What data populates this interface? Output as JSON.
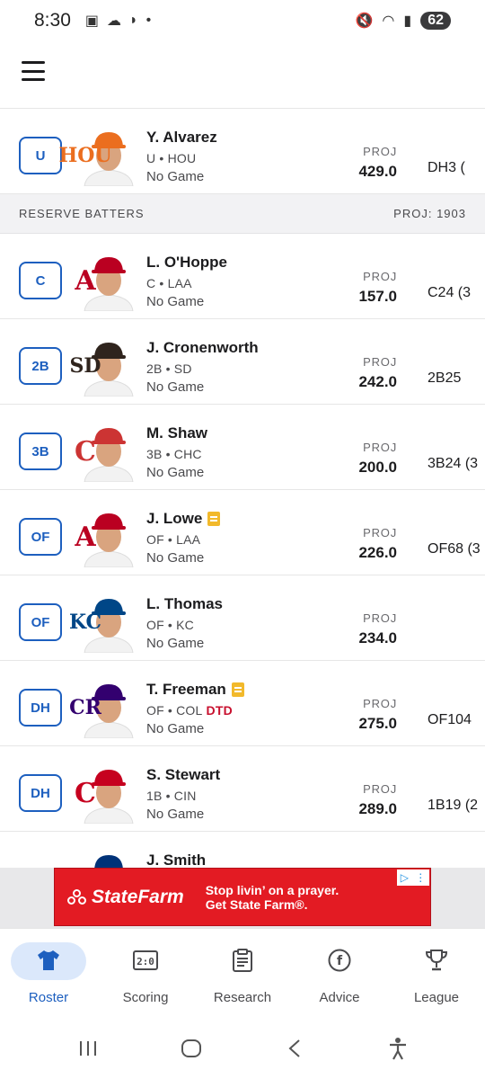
{
  "status_bar": {
    "time": "8:30",
    "battery": "62"
  },
  "active_players": [
    {
      "slot": "U",
      "name": "Y. Alvarez",
      "meta": "U • HOU",
      "game": "No Game",
      "proj_label": "PROJ",
      "proj": "429.0",
      "rank": "DH3 (",
      "team_logo": "HOU",
      "team_color": "#eb6e1f",
      "has_note": false,
      "status": ""
    }
  ],
  "reserve": {
    "title": "RESERVE BATTERS",
    "proj_total": "PROJ: 1903"
  },
  "players": [
    {
      "slot": "C",
      "name": "L. O'Hoppe",
      "meta": "C • LAA",
      "game": "No Game",
      "proj_label": "PROJ",
      "proj": "157.0",
      "rank": "C24 (3",
      "team_logo": "A",
      "team_color": "#ba0021",
      "has_note": false,
      "status": ""
    },
    {
      "slot": "2B",
      "name": "J. Cronenworth",
      "meta": "2B • SD",
      "game": "No Game",
      "proj_label": "PROJ",
      "proj": "242.0",
      "rank": "2B25",
      "team_logo": "SD",
      "team_color": "#2f241d",
      "has_note": false,
      "status": ""
    },
    {
      "slot": "3B",
      "name": "M. Shaw",
      "meta": "3B • CHC",
      "game": "No Game",
      "proj_label": "PROJ",
      "proj": "200.0",
      "rank": "3B24 (3",
      "team_logo": "C",
      "team_color": "#cc3433",
      "has_note": false,
      "status": ""
    },
    {
      "slot": "OF",
      "name": "J. Lowe",
      "meta": "OF • LAA",
      "game": "No Game",
      "proj_label": "PROJ",
      "proj": "226.0",
      "rank": "OF68 (3",
      "team_logo": "A",
      "team_color": "#ba0021",
      "has_note": true,
      "status": ""
    },
    {
      "slot": "OF",
      "name": "L. Thomas",
      "meta": "OF • KC",
      "game": "No Game",
      "proj_label": "PROJ",
      "proj": "234.0",
      "rank": "",
      "team_logo": "KC",
      "team_color": "#004687",
      "has_note": false,
      "status": ""
    },
    {
      "slot": "DH",
      "name": "T. Freeman",
      "meta": "OF • COL",
      "game": "No Game",
      "proj_label": "PROJ",
      "proj": "275.0",
      "rank": "OF104",
      "team_logo": "CR",
      "team_color": "#33006f",
      "has_note": true,
      "status": "DTD"
    },
    {
      "slot": "DH",
      "name": "S. Stewart",
      "meta": "1B • CIN",
      "game": "No Game",
      "proj_label": "PROJ",
      "proj": "289.0",
      "rank": "1B19 (2",
      "team_logo": "C",
      "team_color": "#c6011f",
      "has_note": false,
      "status": ""
    },
    {
      "slot": "",
      "name": "J. Smith",
      "meta": "",
      "game": "",
      "proj_label": "",
      "proj": "",
      "rank": "",
      "team_logo": "T",
      "team_color": "#003278",
      "has_note": false,
      "status": ""
    }
  ],
  "ad": {
    "brand": "StateFarm",
    "line1": "Stop livin’ on a prayer.",
    "line2": "Get State Farm®."
  },
  "bottom_nav": [
    {
      "label": "Roster",
      "icon": "jersey-icon",
      "active": true
    },
    {
      "label": "Scoring",
      "icon": "scoreboard-icon",
      "active": false
    },
    {
      "label": "Research",
      "icon": "clipboard-icon",
      "active": false
    },
    {
      "label": "Advice",
      "icon": "advice-icon",
      "active": false
    },
    {
      "label": "League",
      "icon": "trophy-icon",
      "active": false
    }
  ],
  "colors": {
    "accent": "#1d5fbf",
    "nav_pill": "#dbe8fb",
    "ad_red": "#e31b23",
    "dtd": "#c8102e"
  }
}
